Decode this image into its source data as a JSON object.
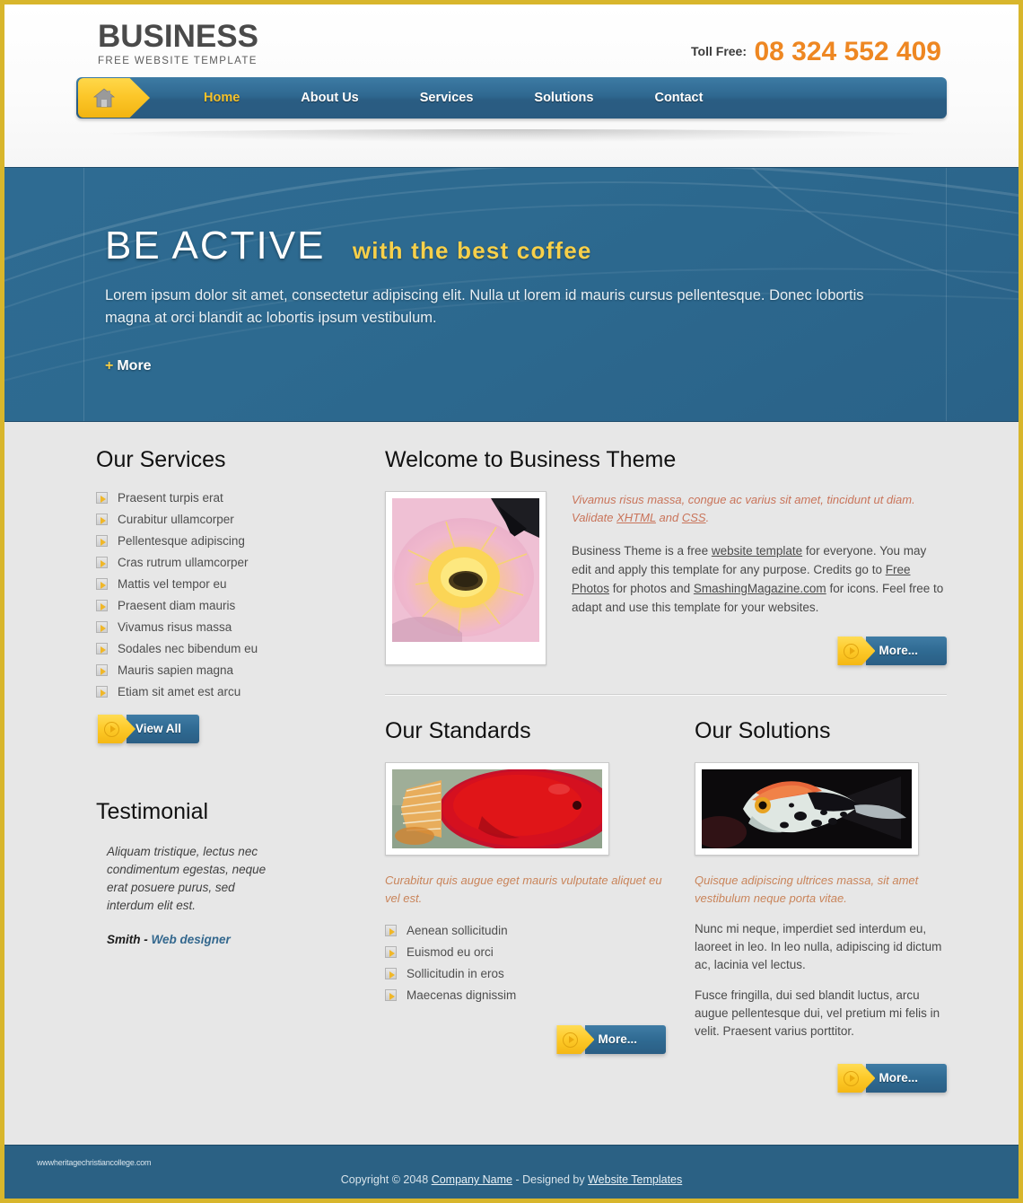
{
  "header": {
    "brand_title": "BUSINESS",
    "brand_subtitle": "FREE WEBSITE TEMPLATE",
    "tollfree_label": "Toll Free:",
    "tollfree_number": "08 324 552 409",
    "home_icon": "house-icon"
  },
  "nav": {
    "items": [
      {
        "label": "Home",
        "active": true
      },
      {
        "label": "About Us",
        "active": false
      },
      {
        "label": "Services",
        "active": false
      },
      {
        "label": "Solutions",
        "active": false
      },
      {
        "label": "Contact",
        "active": false
      }
    ]
  },
  "banner": {
    "title": "BE ACTIVE",
    "subtitle": "with the best coffee",
    "paragraph": "Lorem ipsum dolor sit amet, consectetur adipiscing elit. Nulla ut lorem id mauris cursus pellentesque. Donec lobortis magna at orci blandit ac lobortis ipsum vestibulum.",
    "more_label": "More",
    "more_plus": "+"
  },
  "services": {
    "title": "Our Services",
    "items": [
      "Praesent turpis erat",
      "Curabitur ullamcorper",
      "Pellentesque adipiscing",
      "Cras rutrum ullamcorper",
      "Mattis vel tempor eu",
      "Praesent diam mauris",
      "Vivamus risus massa",
      "Sodales nec bibendum eu",
      "Mauris sapien magna",
      "Etiam sit amet est arcu"
    ],
    "button_label": "View All"
  },
  "testimonial": {
    "title": "Testimonial",
    "quote": "Aliquam tristique, lectus nec condimentum egestas, neque erat posuere purus, sed interdum elit est.",
    "author_name": "Smith - ",
    "author_role": "Web designer"
  },
  "welcome": {
    "title": "Welcome to Business Theme",
    "lead_part1": "Vivamus risus massa, congue ac varius sit amet, tincidunt ut diam. Validate ",
    "lead_link1": "XHTML",
    "lead_mid": " and ",
    "lead_link2": "CSS",
    "lead_end": ".",
    "body_part1": "Business Theme is a free ",
    "body_link1": "website template",
    "body_part2": " for everyone. You may edit and apply this template for any purpose. Credits go to ",
    "body_link2": "Free Photos",
    "body_part3": " for photos and ",
    "body_link3": "SmashingMagazine.com",
    "body_part4": " for icons. Feel free to adapt and use this template for your websites.",
    "button_label": "More...",
    "image_alt": "pink-lotus-flower-with-bee-photo"
  },
  "standards": {
    "title": "Our Standards",
    "caption": "Curabitur quis augue eget mauris vulputate aliquet eu vel est.",
    "items": [
      "Aenean sollicitudin",
      "Euismod eu orci",
      "Sollicitudin in eros",
      "Maecenas dignissim"
    ],
    "button_label": "More...",
    "image_alt": "red-discus-fish-photo"
  },
  "solutions": {
    "title": "Our Solutions",
    "caption": "Quisque adipiscing ultrices massa, sit amet vestibulum neque porta vitae.",
    "para1": "Nunc mi neque, imperdiet sed interdum eu, laoreet in leo. In leo nulla, adipiscing id dictum ac, lacinia vel lectus.",
    "para2": "Fusce fringilla, dui sed blandit luctus, arcu augue pellentesque dui, vel pretium mi felis in velit. Praesent varius porttitor.",
    "button_label": "More...",
    "image_alt": "white-angelfish-photo"
  },
  "footer": {
    "watermark": "wwwheritagechristiancollege.com",
    "copyright_prefix": "Copyright © 2048 ",
    "company_link": "Company Name",
    "copyright_mid": " - Designed by ",
    "designer_link": "Website Templates"
  },
  "colors": {
    "frame_gold": "#d8b62c",
    "nav_blue": "#2f6890",
    "accent_gold": "#f6c22a",
    "phone_orange": "#ee8722",
    "banner_blue": "#2d6a90",
    "page_gray": "#e7e7e7",
    "lead_orange": "#c9745a",
    "footer_blue": "#2b6184"
  }
}
